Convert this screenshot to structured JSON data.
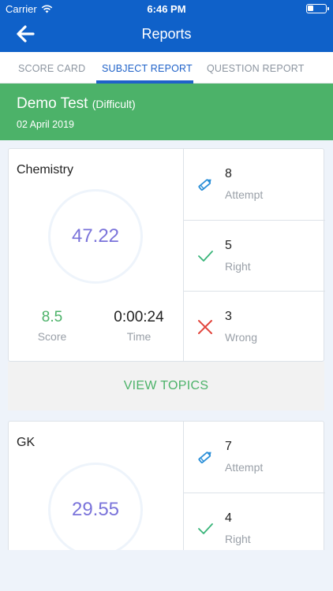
{
  "status_bar": {
    "carrier": "Carrier",
    "time": "6:46 PM"
  },
  "nav": {
    "title": "Reports"
  },
  "tabs": [
    {
      "label": "SCORE CARD",
      "active": false
    },
    {
      "label": "SUBJECT REPORT",
      "active": true
    },
    {
      "label": "QUESTION REPORT",
      "active": false
    }
  ],
  "test": {
    "name": "Demo Test",
    "level": "(Difficult)",
    "date": "02 April 2019"
  },
  "subjects": [
    {
      "name": "Chemistry",
      "percentage": "47.22",
      "score": "8.5",
      "score_label": "Score",
      "time": "0:00:24",
      "time_label": "Time",
      "attempt": "8",
      "attempt_label": "Attempt",
      "right": "5",
      "right_label": "Right",
      "wrong": "3",
      "wrong_label": "Wrong"
    },
    {
      "name": "GK",
      "percentage": "29.55",
      "attempt": "7",
      "attempt_label": "Attempt",
      "right": "4",
      "right_label": "Right"
    }
  ],
  "view_topics_label": "VIEW TOPICS",
  "colors": {
    "brand_blue": "#0f61c9",
    "header_green": "#4cb269",
    "percent_purple": "#7a73da",
    "wrong_red": "#e2453c"
  }
}
